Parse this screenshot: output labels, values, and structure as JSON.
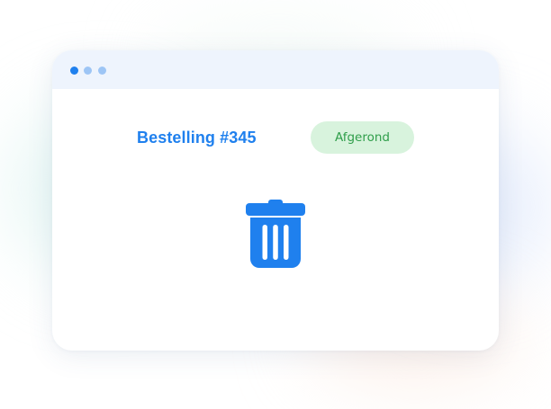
{
  "colors": {
    "accent": "#1f80ee",
    "titlebar_dot_active": "#1f80ee",
    "titlebar_dot_inactive": "#9dc5f5",
    "badge_bg": "#d8f3dd",
    "badge_text": "#2f9e4a",
    "icon": "#1f80ee"
  },
  "order": {
    "title": "Bestelling #345",
    "status": "Afgerond"
  },
  "icons": {
    "delete": "trash-icon"
  }
}
